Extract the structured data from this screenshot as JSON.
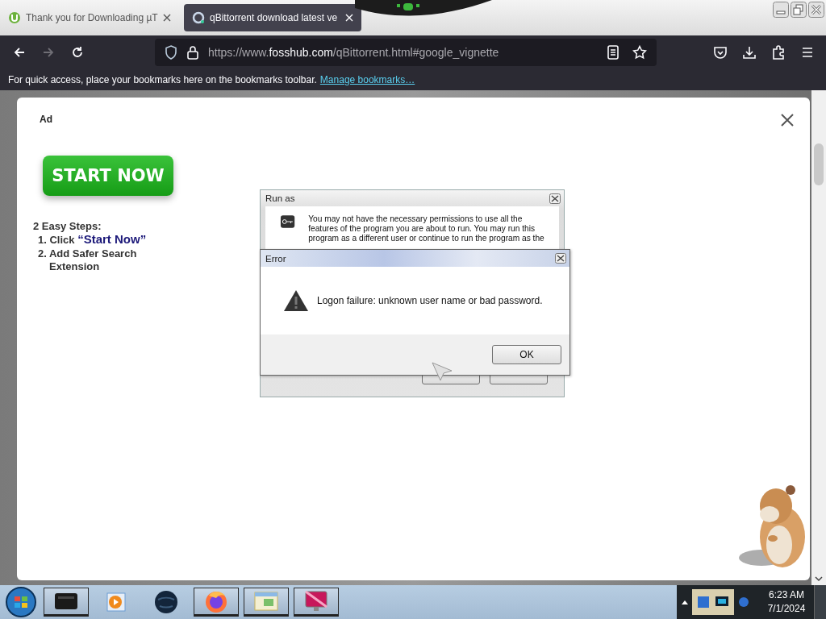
{
  "browser": {
    "tabs": [
      {
        "title": "Thank you for Downloading µT",
        "selected": false
      },
      {
        "title": "qBittorrent download latest ve",
        "selected": true
      }
    ],
    "nav": [
      {
        "kind": "back",
        "disabled": false
      },
      {
        "kind": "forward",
        "disabled": true
      },
      {
        "kind": "reload",
        "disabled": false
      }
    ],
    "url": {
      "prefix": "https://www.",
      "host": "fosshub.com",
      "path": "/qBittorrent.html#google_vignette"
    },
    "bookmarks_bar": {
      "text": "For quick access, place your bookmarks here on the bookmarks toolbar.",
      "link": "Manage bookmarks…"
    }
  },
  "ad": {
    "label": "Ad",
    "button": "START NOW",
    "steps_title": "2 Easy Steps:",
    "steps": [
      {
        "text": "1. Click",
        "highlight": "“Start Now”"
      },
      {
        "text": "2. Add Safer Search Extension"
      }
    ]
  },
  "run_as_dialog": {
    "title": "Run as",
    "message": "You may not have the necessary permissions to use all the features of the program you are about to run. You may run this program as a different user or continue to run the program as the"
  },
  "error_dialog": {
    "title": "Error",
    "message": "Logon failure: unknown user name or bad password.",
    "button": "OK"
  },
  "taskbar": {
    "time": "6:23 AM",
    "date": "7/1/2024"
  }
}
